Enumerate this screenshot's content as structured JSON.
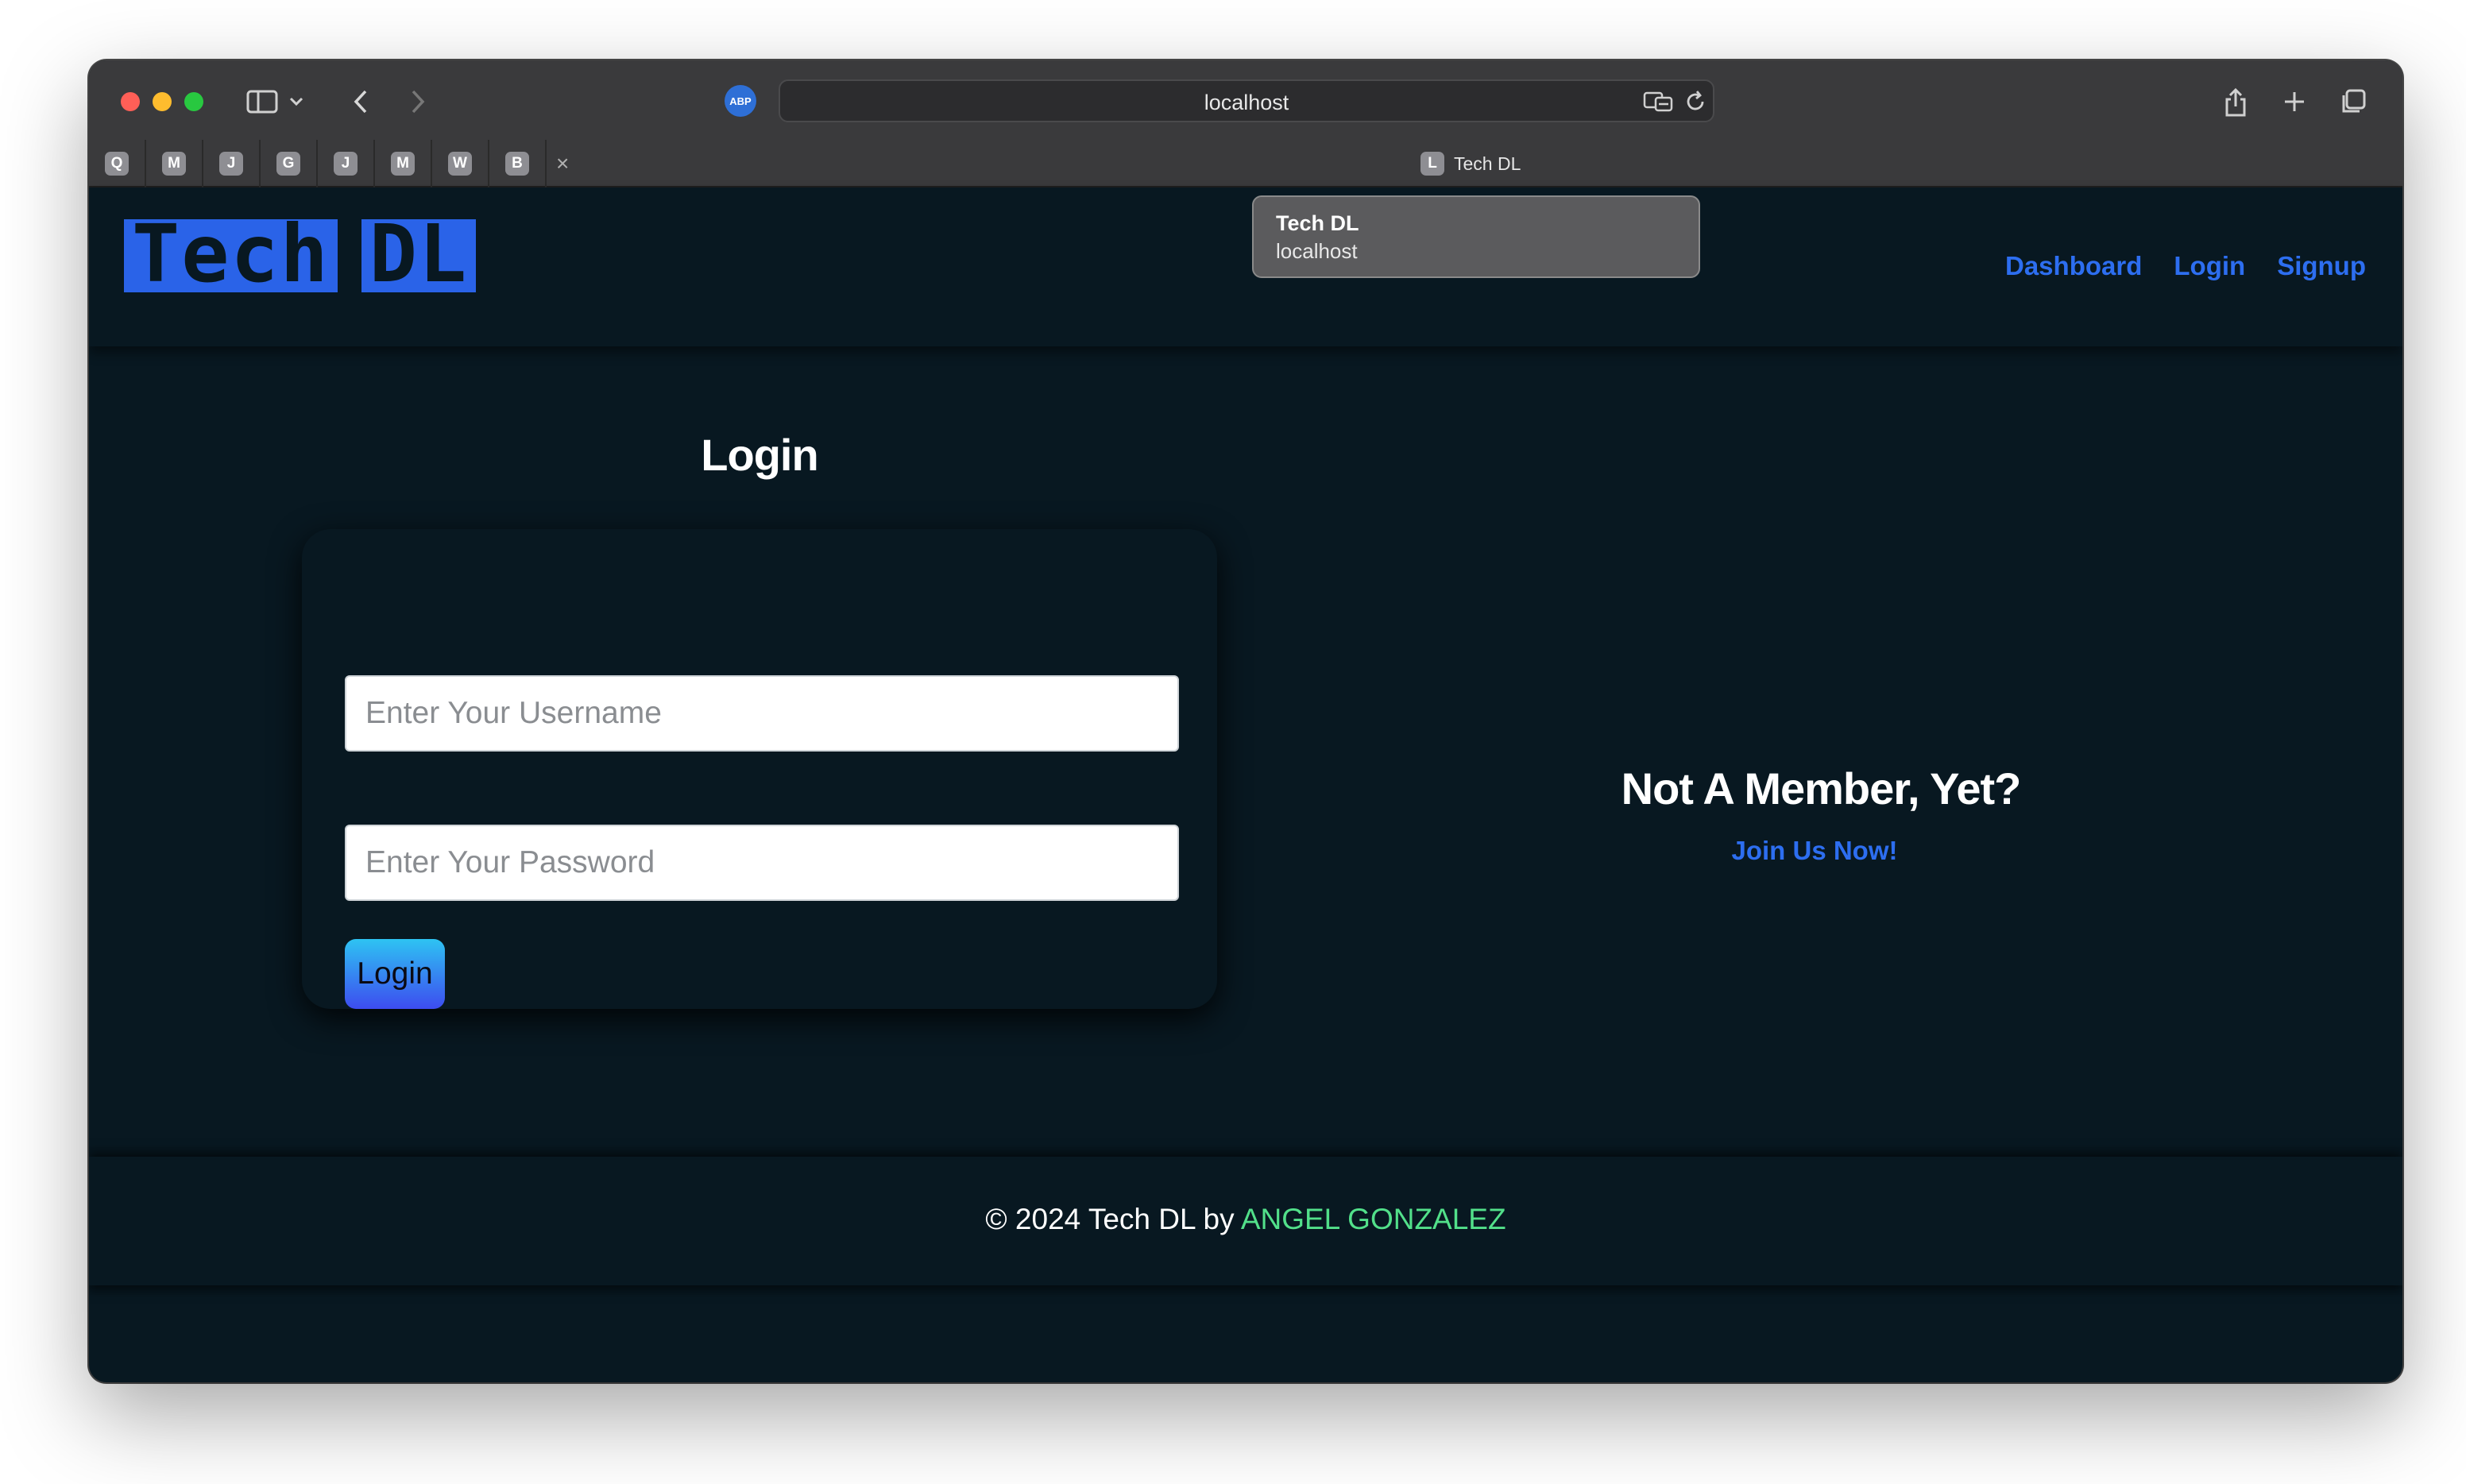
{
  "browser": {
    "url": "localhost",
    "adblock_badge": "ABP",
    "pinned_tabs": [
      "Q",
      "M",
      "J",
      "G",
      "J",
      "M",
      "W",
      "B"
    ],
    "active_tab": {
      "favicon_letter": "L",
      "title": "Tech DL"
    },
    "tooltip": {
      "title": "Tech DL",
      "subtitle": "localhost"
    }
  },
  "site": {
    "logo": {
      "word1": "Tech",
      "word2": "DL"
    },
    "nav": [
      "Dashboard",
      "Login",
      "Signup"
    ]
  },
  "login": {
    "heading": "Login",
    "username_placeholder": "Enter Your Username",
    "password_placeholder": "Enter Your Password",
    "button_label": "Login"
  },
  "signup_promo": {
    "heading": "Not A Member, Yet?",
    "link": "Join Us Now!"
  },
  "footer": {
    "prefix": "© 2024 Tech DL by",
    "author": "ANGEL GONZALEZ"
  },
  "colors": {
    "background": "#081821",
    "accent_blue": "#2d6ef0",
    "author_green": "#52e08a"
  }
}
